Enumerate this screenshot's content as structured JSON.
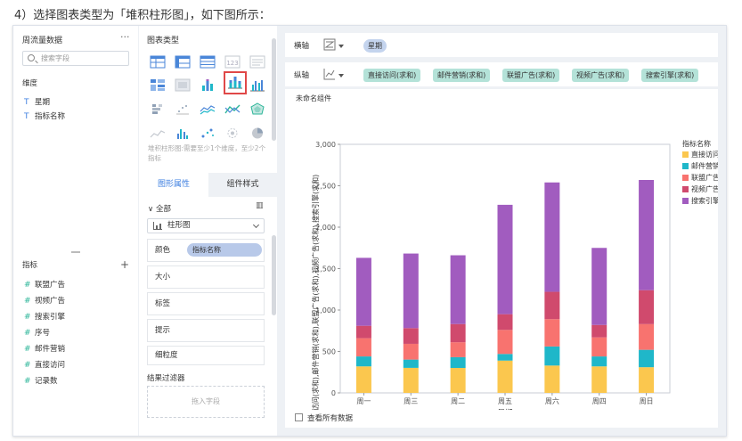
{
  "caption": "4）选择图表类型为「堆积柱形图」，如下图所示：",
  "data_panel": {
    "title": "周流量数据",
    "more": "···",
    "search_placeholder": "搜索字段",
    "dimension_label": "维度",
    "dimensions": [
      {
        "type": "T",
        "name": "星期"
      },
      {
        "type": "T",
        "name": "指标名称"
      }
    ],
    "metric_label": "指标",
    "metrics": [
      {
        "type": "#",
        "name": "联盟广告"
      },
      {
        "type": "#",
        "name": "视频广告"
      },
      {
        "type": "#",
        "name": "搜索引擎"
      },
      {
        "type": "#",
        "name": "序号"
      },
      {
        "type": "#",
        "name": "邮件营销"
      },
      {
        "type": "#",
        "name": "直接访问"
      },
      {
        "type": "#",
        "name": "记录数"
      }
    ]
  },
  "chart_type_panel": {
    "title": "图表类型",
    "hint": "堆积柱形图:需要至少1个维度，至少2个指标",
    "tab_graph": "图形属性",
    "tab_component": "组件样式",
    "all_label": "全部",
    "type_select": "柱形图",
    "color_label": "颜色",
    "color_value": "指标名称",
    "size_label": "大小",
    "label_label": "标签",
    "tooltip_label": "提示",
    "granularity_label": "细粒度",
    "filter_title": "结果过滤器",
    "drop_hint": "拖入字段"
  },
  "axes": {
    "x_label": "横轴",
    "x_fields": [
      "星期"
    ],
    "y_label": "纵轴",
    "y_fields": [
      "直接访问(求和)",
      "邮件营销(求和)",
      "联盟广告(求和)",
      "视频广告(求和)",
      "搜索引擎(求和)"
    ]
  },
  "chart_title": "未命名组件",
  "show_all_label": "查看所有数据",
  "chart_data": {
    "type": "bar",
    "stacked": true,
    "categories": [
      "周一",
      "周三",
      "周二",
      "周五",
      "周六",
      "周四",
      "周日"
    ],
    "xlabel": "星期",
    "ylabel": "直接访问(求和),邮件营销(求和),联盟广告(求和),视频广告(求和),搜索引擎(求和)",
    "ylim": [
      0,
      3000
    ],
    "yticks": [
      "0",
      "500",
      "1,000",
      "1,500",
      "2,000",
      "2,500",
      "3,000"
    ],
    "legend_title": "指标名称",
    "legend_position": "right",
    "series": [
      {
        "name": "直接访问",
        "color": "#fbc74e",
        "values": [
          320,
          302,
          301,
          390,
          330,
          320,
          310
        ]
      },
      {
        "name": "邮件营销",
        "color": "#1fb7c9",
        "values": [
          120,
          100,
          130,
          80,
          230,
          120,
          210
        ]
      },
      {
        "name": "联盟广告",
        "color": "#f8736f",
        "values": [
          220,
          190,
          180,
          290,
          330,
          230,
          310
        ]
      },
      {
        "name": "视频广告",
        "color": "#d04a6d",
        "values": [
          150,
          190,
          220,
          190,
          330,
          150,
          410
        ]
      },
      {
        "name": "搜索引擎",
        "color": "#a15cbf",
        "values": [
          820,
          900,
          830,
          1320,
          1320,
          930,
          1330
        ]
      }
    ]
  }
}
